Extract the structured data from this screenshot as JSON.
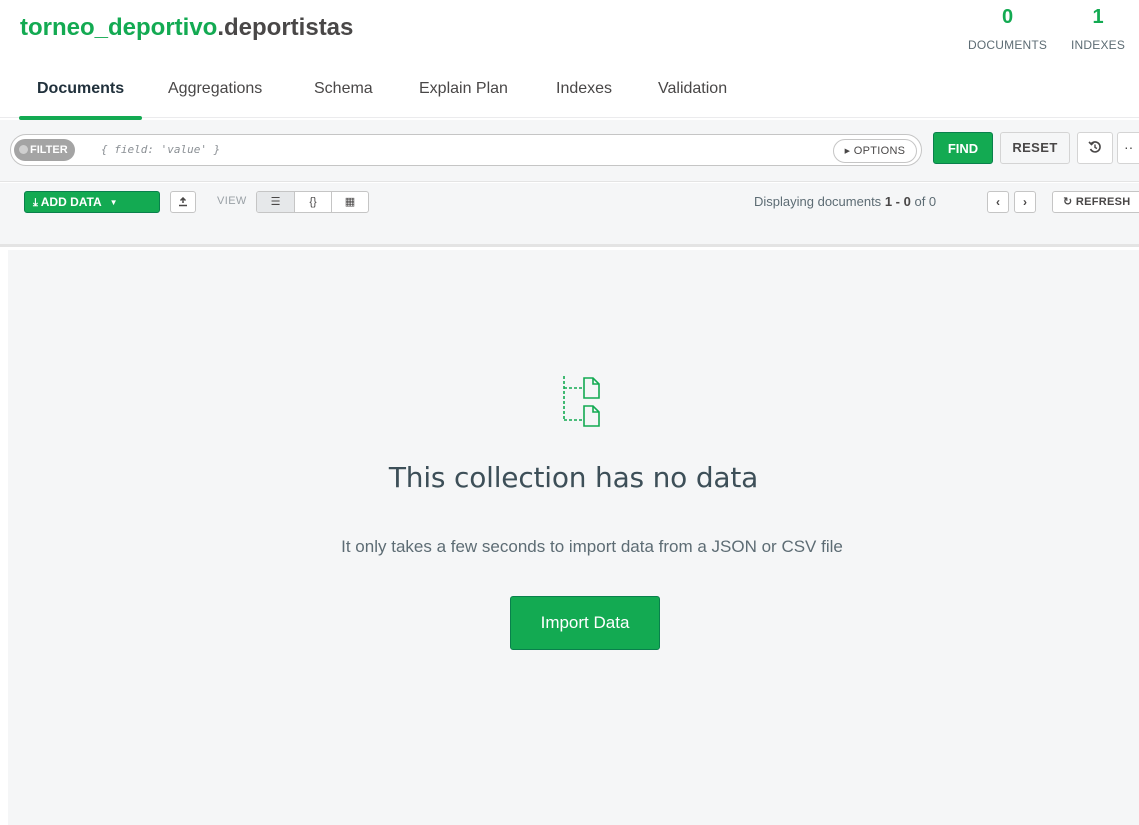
{
  "header": {
    "database": "torneo_deportivo",
    "collection": ".deportistas",
    "stats": [
      {
        "value": "0",
        "label": "DOCUMENTS"
      },
      {
        "value": "1",
        "label": "INDEXES"
      }
    ]
  },
  "tabs": [
    {
      "label": "Documents",
      "active": true
    },
    {
      "label": "Aggregations"
    },
    {
      "label": "Schema"
    },
    {
      "label": "Explain Plan"
    },
    {
      "label": "Indexes"
    },
    {
      "label": "Validation"
    }
  ],
  "querybar": {
    "filter_label": "FILTER",
    "filter_placeholder": "{ field: 'value' }",
    "options_label": "OPTIONS",
    "find_label": "FIND",
    "reset_label": "RESET",
    "history_icon": "history-icon",
    "more_label": "··"
  },
  "toolbar": {
    "add_data_label": "ADD DATA",
    "view_label": "VIEW",
    "view_modes": [
      "list-view-icon",
      "json-view-icon",
      "table-view-icon"
    ],
    "displaying_prefix": "Displaying documents",
    "range_start": "1",
    "range_sep": " - ",
    "range_end": "0",
    "of_text": "of 0",
    "refresh_label": "REFRESH"
  },
  "empty_state": {
    "title": "This collection has no data",
    "subtitle": "It only takes a few seconds to import data from a JSON or CSV file",
    "button_label": "Import Data"
  },
  "colors": {
    "brand_green": "#13aa52",
    "background": "#f5f6f7"
  }
}
